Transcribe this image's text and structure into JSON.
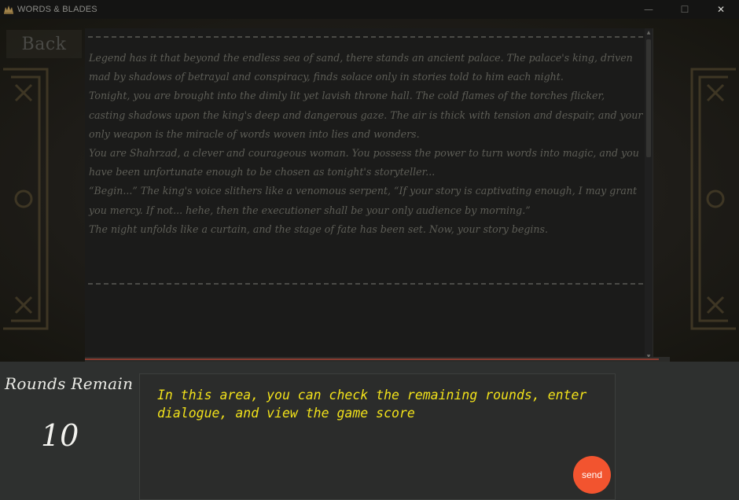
{
  "window": {
    "title": "WORDS & BLADES",
    "controls": [
      "minimize",
      "maximize",
      "close"
    ],
    "close_glyph": "✕",
    "minimize_glyph": "—",
    "maximize_glyph": "☐"
  },
  "nav": {
    "back_label": "Back"
  },
  "story": {
    "paragraphs": [
      "Legend has it that beyond the endless sea of sand, there stands an ancient palace. The palace's king, driven mad by shadows of betrayal and conspiracy, finds solace only in stories told to him each night.",
      "Tonight, you are brought into the dimly lit yet lavish throne hall. The cold flames of the torches flicker, casting shadows upon the king's deep and dangerous gaze. The air is thick with tension and despair, and your only weapon is the miracle of words woven into lies and wonders.",
      "You are Shahrzad, a clever and courageous woman. You possess the power to turn words into magic, and you have been unfortunate enough to be chosen as tonight's storyteller...",
      "“Begin...” The king's voice slithers like a venomous serpent, “If your story is captivating enough, I may grant you mercy. If not... hehe, then the executioner shall be your only audience by morning.”",
      "The night unfolds like a curtain, and the stage of fate has been set. Now, your story begins."
    ]
  },
  "rounds": {
    "label": "Rounds Remain",
    "value": "10"
  },
  "dialogue": {
    "hint": "In this area, you can check the remaining rounds, enter dialogue, and view the game score",
    "send_label": "send"
  },
  "colors": {
    "accent_send": "#f2542f",
    "hint_text": "#f2e21a",
    "story_text": "#5d5d56"
  }
}
